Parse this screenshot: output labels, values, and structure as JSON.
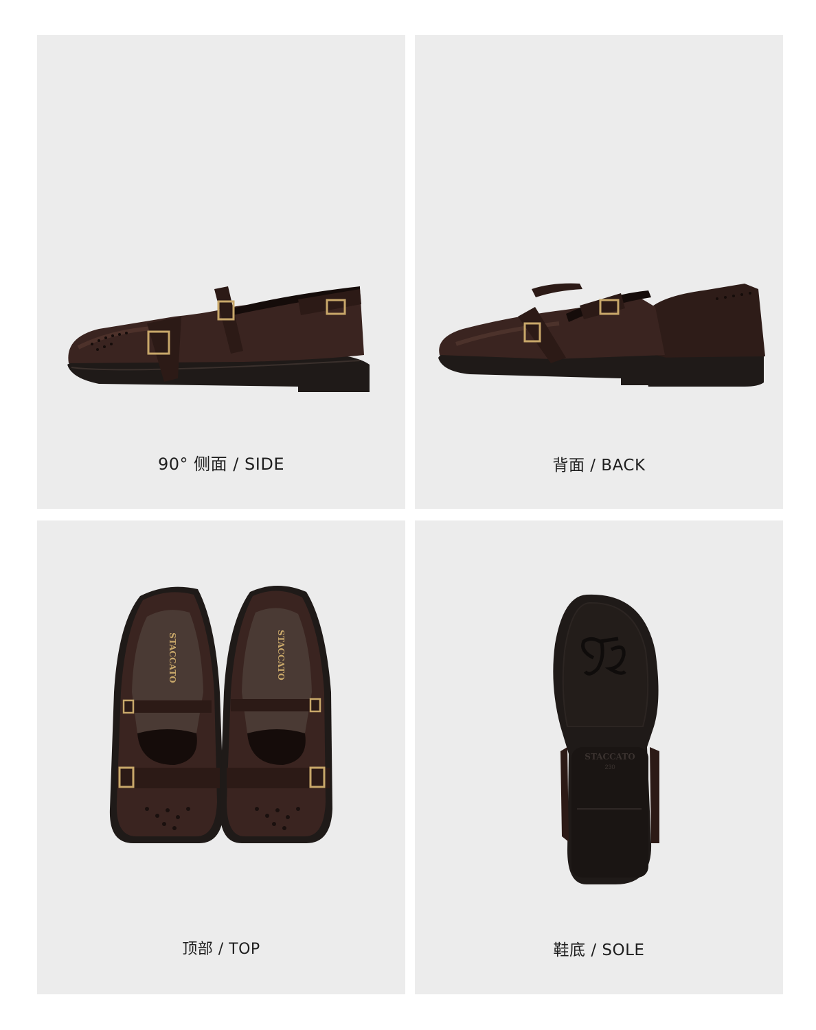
{
  "brand": "STACCATO",
  "sole_size": "230",
  "colors": {
    "panel_bg": "#ececec",
    "leather": "#3a2420",
    "leather_dark": "#241512",
    "sole": "#1f1a18",
    "buckle": "#c9a86a",
    "caption_text": "#1e1e1e"
  },
  "panels": [
    {
      "id": "side",
      "caption": "90°  侧面  /  SIDE"
    },
    {
      "id": "back",
      "caption": "背面  /  BACK"
    },
    {
      "id": "top",
      "caption": "顶部  /  TOP"
    },
    {
      "id": "sole",
      "caption": "鞋底 / SOLE"
    }
  ]
}
